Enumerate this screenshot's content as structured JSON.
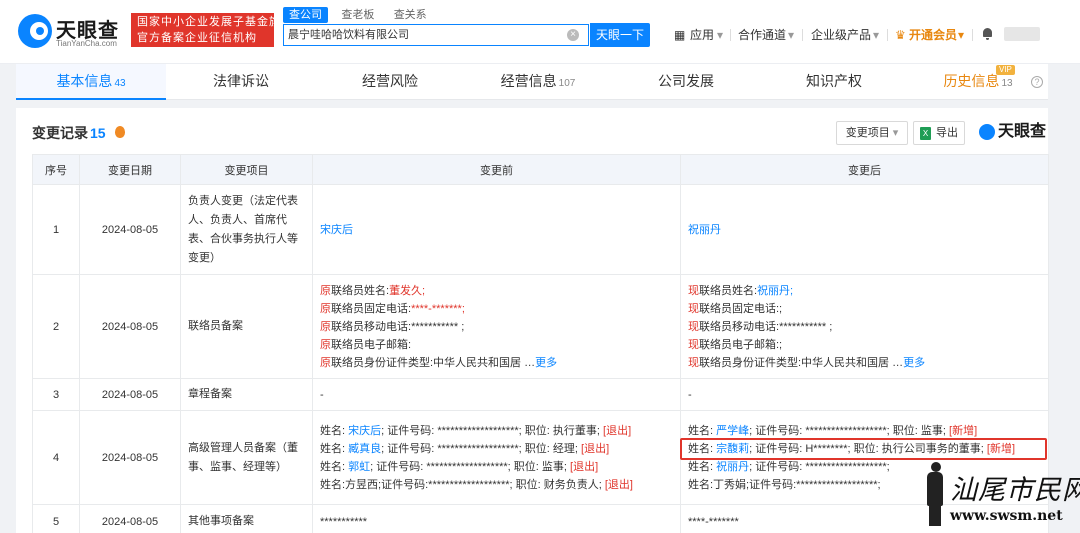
{
  "header": {
    "logo": {
      "name": "天眼查",
      "domain": "TianYanCha.com"
    },
    "banner": {
      "line1": "国家中小企业发展子基金旗下",
      "line2": "官方备案企业征信机构"
    },
    "search_tabs": [
      "查公司",
      "查老板",
      "查关系"
    ],
    "search_value": "晨宁哇哈哈饮料有限公司",
    "search_button": "天眼一下",
    "nav": {
      "apps": "应用",
      "channel": "合作通道",
      "enterprise": "企业级产品",
      "vip": "开通会员"
    }
  },
  "tabs": [
    {
      "label": "基本信息",
      "count": "43"
    },
    {
      "label": "法律诉讼",
      "count": ""
    },
    {
      "label": "经营风险",
      "count": ""
    },
    {
      "label": "经营信息",
      "count": "107"
    },
    {
      "label": "公司发展",
      "count": ""
    },
    {
      "label": "知识产权",
      "count": ""
    },
    {
      "label": "历史信息",
      "count": "13",
      "badge": "VIP"
    }
  ],
  "panel": {
    "title": "变更记录",
    "count": "15",
    "filter_button": "变更项目",
    "export_button": "导出",
    "export_icon": "X",
    "brand": "天眼查"
  },
  "table": {
    "headers": [
      "序号",
      "变更日期",
      "变更项目",
      "变更前",
      "变更后"
    ],
    "rows": [
      {
        "no": "1",
        "date": "2024-08-05",
        "item": "负责人变更（法定代表人、负责人、首席代表、合伙事务执行人等变更）",
        "before": "宋庆后",
        "after": "祝丽丹"
      },
      {
        "no": "2",
        "date": "2024-08-05",
        "item": "联络员备案",
        "before": {
          "prefix": "原",
          "lines": [
            "联络员姓名:",
            "联络员固定电话:",
            "联络员移动电话:",
            "联络员电子邮箱:",
            "联络员身份证件类型:中华人民共和国居"
          ],
          "values": [
            "董发久;",
            "****-*******;",
            "*********** ;",
            "",
            ""
          ],
          "more": "更多"
        },
        "after": {
          "prefix": "现",
          "lines": [
            "联络员姓名:",
            "联络员固定电话:;",
            "联络员移动电话:",
            "联络员电子邮箱:;",
            "联络员身份证件类型:中华人民共和国居"
          ],
          "values": [
            "祝丽丹;",
            "",
            "*********** ;",
            "",
            ""
          ],
          "more": "更多"
        }
      },
      {
        "no": "3",
        "date": "2024-08-05",
        "item": "章程备案",
        "before": "-",
        "after": "-"
      },
      {
        "no": "4",
        "date": "2024-08-05",
        "item": "高级管理人员备案（董事、监事、经理等）",
        "before": [
          {
            "pre": "姓名: ",
            "name": "宋庆后",
            "mid": "; 证件号码: *******************; 职位: 执行董事; ",
            "tag": "[退出]"
          },
          {
            "pre": "姓名: ",
            "name": "臧真良",
            "mid": "; 证件号码: *******************; 职位: 经理; ",
            "tag": "[退出]"
          },
          {
            "pre": "姓名: ",
            "name": "郭虹",
            "mid": "; 证件号码: *******************; 职位: 监事; ",
            "tag": "[退出]"
          },
          {
            "pre": "姓名:方昱西;",
            "name": "",
            "mid": "证件号码:*******************; 职位: 财务负责人; ",
            "tag": "[退出]"
          }
        ],
        "after": [
          {
            "pre": "姓名: ",
            "name": "严学峰",
            "mid": "; 证件号码: *******************; 职位: 监事; ",
            "tag": "[新增]"
          },
          {
            "pre": "姓名: ",
            "name": "宗馥莉",
            "mid": "; 证件号码: H********; 职位: 执行公司事务的董事; ",
            "tag": "[新增]"
          },
          {
            "pre": "姓名: ",
            "name": "祝丽丹",
            "mid": "; 证件号码: *******************; ",
            "tag": ""
          },
          {
            "pre": "姓名:丁秀娟;",
            "name": "",
            "mid": "证件号码:*******************;",
            "tag": ""
          }
        ]
      },
      {
        "no": "5",
        "date": "2024-08-05",
        "item": "其他事项备案",
        "before": "***********",
        "after": "****-*******"
      }
    ]
  },
  "watermark": {
    "chars": "汕尾市民网",
    "url": "www.swsm.net"
  },
  "colors": {
    "accent": "#0a84ff",
    "red": "#e0352b",
    "orange": "#e8870f"
  }
}
